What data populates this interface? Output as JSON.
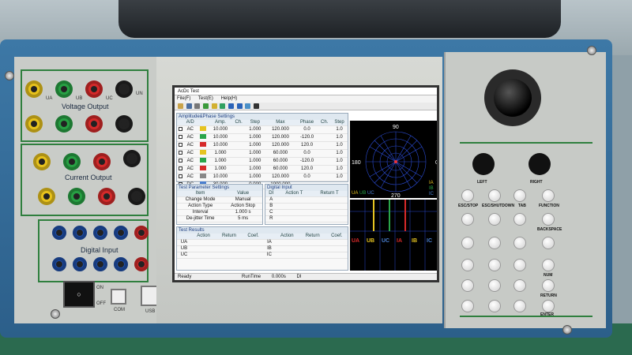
{
  "panel": {
    "voltage_output": "Voltage Output",
    "current_output": "Current Output",
    "digital_input": "Digital Input",
    "voltage_jacks": [
      "UA",
      "UB",
      "UC",
      "UN"
    ],
    "com_label": "COM",
    "usb_label": "USB",
    "on_label": "ON",
    "off_label": "OFF"
  },
  "screen": {
    "window_title": "AcDc Test",
    "menu": [
      "File(F)",
      "Test(E)",
      "Help(H)"
    ],
    "amp_phase": {
      "title": "Amplitude&Phase Settings",
      "headers": [
        "A/D",
        "",
        "Amp.",
        "Ch.",
        "Step",
        "Max",
        "Phase",
        "Ch.",
        "Step"
      ],
      "rows": [
        [
          "AC",
          "#e6c422",
          "10.000",
          "",
          "1.000",
          "120.000",
          "0.0",
          "",
          "1.0"
        ],
        [
          "AC",
          "#2aa54a",
          "10.000",
          "",
          "1.000",
          "120.000",
          "-120.0",
          "",
          "1.0"
        ],
        [
          "AC",
          "#d62a2a",
          "10.000",
          "",
          "1.000",
          "120.000",
          "120.0",
          "",
          "1.0"
        ],
        [
          "AC",
          "#e6c422",
          "1.000",
          "",
          "1.000",
          "60.000",
          "0.0",
          "",
          "1.0"
        ],
        [
          "AC",
          "#2aa54a",
          "1.000",
          "",
          "1.000",
          "60.000",
          "-120.0",
          "",
          "1.0"
        ],
        [
          "AC",
          "#d62a2a",
          "1.000",
          "",
          "1.000",
          "60.000",
          "120.0",
          "",
          "1.0"
        ],
        [
          "AC",
          "#888888",
          "10.000",
          "",
          "1.000",
          "120.000",
          "0.0",
          "",
          "1.0"
        ],
        [
          "DC",
          "#4a7fd0",
          "30.000",
          "",
          "0.000",
          "1000.000",
          "",
          "",
          ""
        ]
      ]
    },
    "test_params": {
      "title": "Test Parameter Settings",
      "headers": [
        "Item",
        "Value"
      ],
      "rows": [
        [
          "Change Mode",
          "Manual"
        ],
        [
          "Action Type",
          "Action Stop"
        ],
        [
          "Interval",
          "1.000 s"
        ],
        [
          "De-jitter Time",
          "5 ms"
        ]
      ]
    },
    "digital_input": {
      "title": "Digital Input",
      "headers": [
        "DI",
        "Action T",
        "Return T"
      ],
      "rows": [
        "A",
        "B",
        "C",
        "R"
      ]
    },
    "results": {
      "title": "Test Results",
      "headers": [
        "",
        "Action",
        "Return",
        "Coef.",
        "",
        "Action",
        "Return",
        "Coef."
      ],
      "rows": [
        [
          "UA",
          "IA"
        ],
        [
          "UB",
          "IB"
        ],
        [
          "UC",
          "IC"
        ]
      ]
    },
    "polar": {
      "top": "90",
      "left": "180",
      "right": "0",
      "bottom": "270"
    },
    "legend": [
      "UA",
      "UB",
      "UC",
      "IA",
      "IB",
      "IC"
    ],
    "wave_labels": [
      "UA",
      "UB",
      "UC",
      "IA",
      "IB",
      "IC"
    ],
    "status": {
      "ready": "Ready",
      "runtime_label": "RunTime",
      "runtime_value": "0.000s",
      "di": "DI"
    }
  },
  "keypad": {
    "left": "LEFT",
    "right": "RIGHT",
    "row1": [
      "ESC/STOP",
      "ESC/SHUTDOWN",
      "TAB",
      "FUNCTION"
    ],
    "backspace": "BACKSPACE",
    "num": "NUM",
    "return": "RETURN",
    "enter": "ENTER"
  },
  "colors": {
    "ua": "#e6c422",
    "ub": "#2aa54a",
    "uc": "#d62a2a",
    "ia": "#e6c422",
    "ib": "#2aa54a",
    "ic": "#d62a2a"
  }
}
